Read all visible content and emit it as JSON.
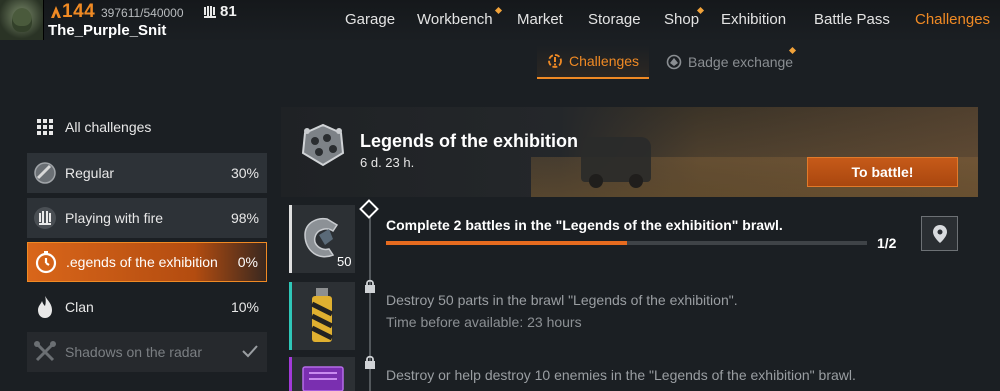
{
  "player": {
    "level": "144",
    "xp": "397611/540000",
    "prestige": "81",
    "name": "The_Purple_Snit"
  },
  "nav": {
    "items": [
      {
        "label": "Garage",
        "dot": false
      },
      {
        "label": "Workbench",
        "dot": true
      },
      {
        "label": "Market",
        "dot": false
      },
      {
        "label": "Storage",
        "dot": false
      },
      {
        "label": "Shop",
        "dot": true
      },
      {
        "label": "Exhibition",
        "dot": false
      },
      {
        "label": "Battle Pass",
        "dot": false
      },
      {
        "label": "Challenges",
        "dot": false,
        "active": true
      }
    ]
  },
  "subtabs": {
    "challenges": "Challenges",
    "badge_exchange": "Badge exchange"
  },
  "sidebar": {
    "items": [
      {
        "label": "All challenges",
        "pct": ""
      },
      {
        "label": "Regular",
        "pct": "30%"
      },
      {
        "label": "Playing with fire",
        "pct": "98%"
      },
      {
        "label": ".egends of the exhibition",
        "pct": "0%"
      },
      {
        "label": "Clan",
        "pct": "10%"
      },
      {
        "label": "Shadows on the radar",
        "pct": ""
      }
    ]
  },
  "challenge": {
    "title": "Legends of the exhibition",
    "timer": "6 d. 23 h.",
    "battle_button": "To battle!"
  },
  "tasks": [
    {
      "text": "Complete 2 battles in the \"Legends of the exhibition\" brawl.",
      "progress_text": "1/2",
      "progress": 0.5,
      "reward": "50"
    },
    {
      "text": "Destroy 50 parts in the brawl \"Legends of the exhibition\".",
      "sub": "Time before available: 23 hours"
    },
    {
      "text": "Destroy or help destroy 10 enemies in the \"Legends of the exhibition\" brawl."
    }
  ],
  "colors": {
    "accent": "#f08a24",
    "active_bg": "#d9661a",
    "progress": "#e66b1f"
  }
}
